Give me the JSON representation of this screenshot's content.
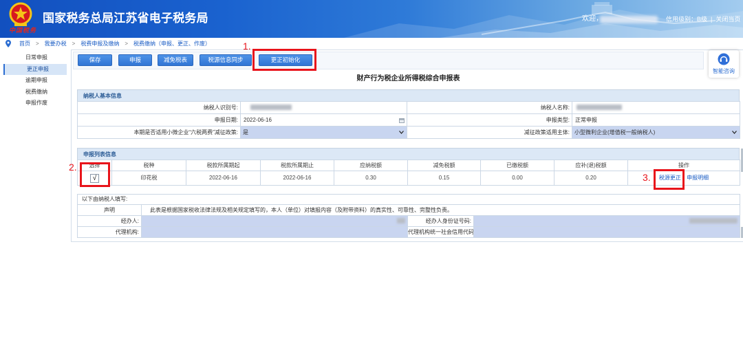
{
  "header": {
    "title": "国家税务总局江苏省电子税务局",
    "logo_text": "中国税务",
    "welcome": "欢迎，",
    "credit_level": "信用级别：B级",
    "divider": "|",
    "close_page": "关闭当页"
  },
  "breadcrumb": {
    "separator": ">",
    "items": [
      "首页",
      "我要办税",
      "税费申报及缴纳",
      "税费缴纳（申报、更正、作废）"
    ]
  },
  "sidebar": {
    "items": [
      {
        "label": "日常申报",
        "active": false
      },
      {
        "label": "更正申报",
        "active": true
      },
      {
        "label": "逾期申报",
        "active": false
      },
      {
        "label": "税费缴纳",
        "active": false
      },
      {
        "label": "申报作废",
        "active": false
      }
    ]
  },
  "toolbar": {
    "buttons": [
      {
        "label": "保存"
      },
      {
        "label": "申报"
      },
      {
        "label": "减免税表"
      },
      {
        "label": "税源信息同步"
      },
      {
        "label": "更正初始化"
      }
    ]
  },
  "help_widget": {
    "label": "智能咨询",
    "icon": "headset-icon"
  },
  "form": {
    "title": "财产行为税企业所得税综合申报表",
    "taxpayer_info": {
      "title": "纳税人基本信息",
      "taxpayer_id_label": "纳税人识别号:",
      "taxpayer_name_label": "纳税人名称:",
      "declare_date_label": "申报日期:",
      "declare_date": "2022-06-16",
      "declare_type_label": "申报类型:",
      "declare_type": "正常申报",
      "policy_label": "本期是否适用小微企业“六税两费”减征政策:",
      "policy_value": "是",
      "policy_subject_label": "减征政策适用主体:",
      "policy_subject_value": "小型微利企业(增值税一般纳税人)"
    },
    "declaration_list": {
      "title": "申报列表信息",
      "columns": [
        "选择",
        "税种",
        "税款所属期起",
        "税款所属期止",
        "应纳税额",
        "减免税额",
        "已缴税额",
        "应补(退)税额",
        "操作"
      ],
      "rows": [
        {
          "selected": true,
          "check_mark": "√",
          "tax_type": "印花税",
          "period_start": "2022-06-16",
          "period_end": "2022-06-16",
          "tax_payable": "0.30",
          "tax_reduction": "0.15",
          "tax_paid": "0.00",
          "tax_due": "0.20",
          "actions": [
            "税源更正",
            "申报明细"
          ]
        }
      ]
    },
    "filler_info": {
      "title": "以下由纳税人填写:",
      "declaration_label": "声明",
      "declaration_text": "此表是根据国家税收法律法规及相关规定填写的，本人（单位）对填报内容（及附带资料）的真实性、可靠性、完整性负责。",
      "agent_label": "经办人:",
      "agent_id_label": "经办人身份证号码:",
      "agency_label": "代理机构:",
      "agency_code_label": "代理机构统一社会信用代码:"
    }
  },
  "annotations": {
    "step1": "1.",
    "step2": "2.",
    "step3": "3."
  },
  "icons": [
    "tax-emblem-icon",
    "location-pin-icon",
    "calendar-icon",
    "chevron-down-icon",
    "checkbox-icon",
    "headset-icon"
  ],
  "colors": {
    "header_blue": "#1a62cf",
    "button_blue": "#3f86e0",
    "section_header_bg": "#dce8f6",
    "input_bg": "#c9d5f0",
    "annotation_red": "#e8141b",
    "link_blue": "#1a5cc4"
  }
}
